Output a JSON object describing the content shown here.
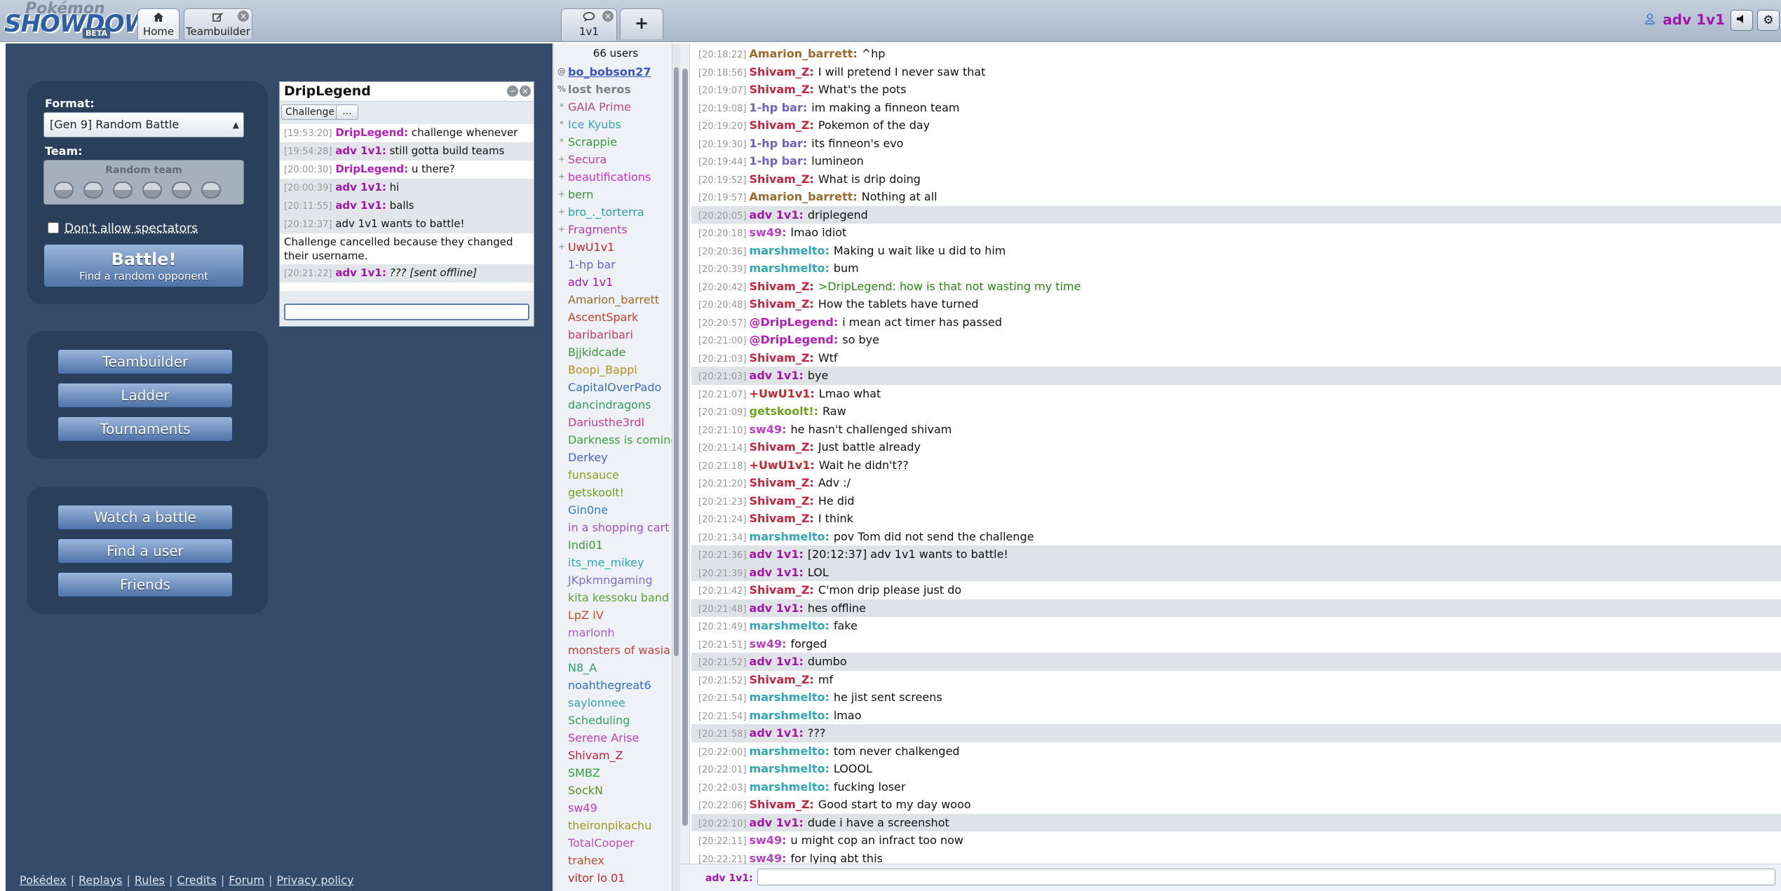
{
  "colors": {
    "accent": "#a316aa",
    "menu_bg": "#344c69",
    "button_blue": "#4e73a8"
  },
  "header": {
    "logo_top": "Pokémon",
    "logo_main": "SHOWDOWN",
    "logo_badge": "BETA",
    "tabs": {
      "home": {
        "icon": "home-icon",
        "label": "Home"
      },
      "teambuilder": {
        "icon": "edit-icon",
        "label": "Teambuilder"
      },
      "room": {
        "icon": "chat-bubble-icon",
        "label": "1v1"
      },
      "new_tab": "+"
    },
    "username": "adv 1v1"
  },
  "mainmenu": {
    "format_label": "Format:",
    "format_value": "[Gen 9] Random Battle",
    "team_label": "Team:",
    "team_value": "Random team",
    "spectators_label": "Don't allow spectators",
    "battle_button": {
      "title": "Battle!",
      "subtitle": "Find a random opponent"
    },
    "group2": [
      "Teambuilder",
      "Ladder",
      "Tournaments"
    ],
    "group3": [
      "Watch a battle",
      "Find a user",
      "Friends"
    ],
    "footer_links": [
      "Pokédex",
      "Replays",
      "Rules",
      "Credits",
      "Forum",
      "Privacy policy"
    ]
  },
  "pm": {
    "title": "DripLegend",
    "challenge_button": "Challenge",
    "more_button": "...",
    "messages": [
      {
        "time": "[19:53:20]",
        "user": "DripLegend:",
        "color": "#b91cb9",
        "text": "challenge whenever",
        "alt": false
      },
      {
        "time": "[19:54:28]",
        "user": "adv 1v1:",
        "color": "#a316aa",
        "text": "still gotta build teams",
        "alt": true
      },
      {
        "time": "[20:00:30]",
        "user": "DripLegend:",
        "color": "#b91cb9",
        "text": "u there?",
        "alt": false
      },
      {
        "time": "[20:00:39]",
        "user": "adv 1v1:",
        "color": "#a316aa",
        "text": "hi",
        "alt": true
      },
      {
        "time": "[20:11:55]",
        "user": "adv 1v1:",
        "color": "#a316aa",
        "text": "balls",
        "alt": true
      },
      {
        "time": "[20:12:37]",
        "user": "",
        "color": "#111111",
        "text": "adv 1v1 wants to battle!",
        "alt": true
      },
      {
        "time": "",
        "user": "",
        "color": "#111111",
        "text": "Challenge cancelled because they changed their username.",
        "alt": false
      },
      {
        "time": "[20:21:22]",
        "user": "adv 1v1:",
        "color": "#a316aa",
        "text": "??? [sent offline]",
        "alt": true,
        "italic": true
      }
    ]
  },
  "userlist": {
    "count": "66 users",
    "users": [
      {
        "rank": "@",
        "name": "bo_bobson27",
        "color": "#3a54c9",
        "bold": true,
        "underline": true
      },
      {
        "rank": "%",
        "name": "lost heros",
        "color": "#7b8089",
        "bold": true
      },
      {
        "rank": "*",
        "name": "GAIA Prime",
        "color": "#c1457f"
      },
      {
        "rank": "*",
        "name": "Ice Kyubs",
        "color": "#3aa4b9"
      },
      {
        "rank": "*",
        "name": "Scrappie",
        "color": "#3a9a3a"
      },
      {
        "rank": "+",
        "name": "Secura",
        "color": "#c13f8f"
      },
      {
        "rank": "+",
        "name": "beautifications",
        "color": "#c92fc9"
      },
      {
        "rank": "+",
        "name": "bern",
        "color": "#3a8f3a"
      },
      {
        "rank": "+",
        "name": "bro_._torterra",
        "color": "#2f9bb0"
      },
      {
        "rank": "+",
        "name": "Fragments",
        "color": "#b43fb4"
      },
      {
        "rank": "+",
        "name": "UwU1v1",
        "color": "#c8242c"
      },
      {
        "rank": "",
        "name": "1-hp bar",
        "color": "#6f5fc9"
      },
      {
        "rank": "",
        "name": "adv 1v1",
        "color": "#a316aa"
      },
      {
        "rank": "",
        "name": "Amarion_barrett",
        "color": "#9a6b2c"
      },
      {
        "rank": "",
        "name": "AscentSpark",
        "color": "#c8402c"
      },
      {
        "rank": "",
        "name": "baribaribari",
        "color": "#c83f5f"
      },
      {
        "rank": "",
        "name": "Bjjkidcade",
        "color": "#3a9a3a"
      },
      {
        "rank": "",
        "name": "Boopi_Bappi",
        "color": "#b38f1f"
      },
      {
        "rank": "",
        "name": "CapitalOverPado",
        "color": "#3a6fc9"
      },
      {
        "rank": "",
        "name": "dancindragons",
        "color": "#2f9f5f"
      },
      {
        "rank": "",
        "name": "Dariusthe3rdl",
        "color": "#c93f8f"
      },
      {
        "rank": "",
        "name": "Darkness is coming",
        "color": "#3aa43a"
      },
      {
        "rank": "",
        "name": "Derkey",
        "color": "#4a5fd9"
      },
      {
        "rank": "",
        "name": "funsauce",
        "color": "#8f9f1f"
      },
      {
        "rank": "",
        "name": "getskoolt!",
        "color": "#6fa21f"
      },
      {
        "rank": "",
        "name": "Gin0ne",
        "color": "#2f7fc9"
      },
      {
        "rank": "",
        "name": "in a shopping cart",
        "color": "#a34fc9"
      },
      {
        "rank": "",
        "name": "Indi01",
        "color": "#3a9a3a"
      },
      {
        "rank": "",
        "name": "its_me_mikey",
        "color": "#2fa7b4"
      },
      {
        "rank": "",
        "name": "JKpkmngaming",
        "color": "#7f6fc9"
      },
      {
        "rank": "",
        "name": "kita kessoku band",
        "color": "#5f9f3a"
      },
      {
        "rank": "",
        "name": "LpZ IV",
        "color": "#c9502c"
      },
      {
        "rank": "",
        "name": "marlonh",
        "color": "#a35fc9"
      },
      {
        "rank": "",
        "name": "monsters of wasia",
        "color": "#c83f3f"
      },
      {
        "rank": "",
        "name": "N8_A",
        "color": "#2f9f6f"
      },
      {
        "rank": "",
        "name": "noahthegreat6",
        "color": "#2f6fc9"
      },
      {
        "rank": "",
        "name": "saylonnee",
        "color": "#3aa4b4"
      },
      {
        "rank": "",
        "name": "Scheduling",
        "color": "#3a9f5f"
      },
      {
        "rank": "",
        "name": "Serene Arise",
        "color": "#b93fb9"
      },
      {
        "rank": "",
        "name": "Shivam_Z",
        "color": "#c8243c"
      },
      {
        "rank": "",
        "name": "SMBZ",
        "color": "#2f9f3a"
      },
      {
        "rank": "",
        "name": "SockN",
        "color": "#5f8f1f"
      },
      {
        "rank": "",
        "name": "sw49",
        "color": "#b93fc9"
      },
      {
        "rank": "",
        "name": "theironpikachu",
        "color": "#9a9a1f"
      },
      {
        "rank": "",
        "name": "TotalCooper",
        "color": "#b94fb9"
      },
      {
        "rank": "",
        "name": "trahex",
        "color": "#b9502c"
      },
      {
        "rank": "",
        "name": "vitor lo 01",
        "color": "#c8242c"
      }
    ]
  },
  "chat": {
    "prompt_user": "adv 1v1:",
    "lines": [
      {
        "time": "[20:18:22]",
        "user": "Amarion_barrett:",
        "color": "#9a6b2c",
        "text": "^hp",
        "alt": false
      },
      {
        "time": "[20:18:56]",
        "user": "Shivam_Z:",
        "color": "#c8243c",
        "text": "I will pretend I never saw that",
        "alt": false
      },
      {
        "time": "[20:19:07]",
        "user": "Shivam_Z:",
        "color": "#c8243c",
        "text": "What's the pots",
        "alt": false
      },
      {
        "time": "[20:19:08]",
        "user": "1-hp bar:",
        "color": "#6f5fc9",
        "text": "im making a finneon team",
        "alt": false
      },
      {
        "time": "[20:19:20]",
        "user": "Shivam_Z:",
        "color": "#c8243c",
        "text": "Pokemon of the day",
        "alt": false
      },
      {
        "time": "[20:19:30]",
        "user": "1-hp bar:",
        "color": "#6f5fc9",
        "text": "its finneon's evo",
        "alt": false
      },
      {
        "time": "[20:19:44]",
        "user": "1-hp bar:",
        "color": "#6f5fc9",
        "text": "lumineon",
        "alt": false
      },
      {
        "time": "[20:19:52]",
        "user": "Shivam_Z:",
        "color": "#c8243c",
        "text": "What is drip doing",
        "alt": false
      },
      {
        "time": "[20:19:57]",
        "user": "Amarion_barrett:",
        "color": "#9a6b2c",
        "text": "Nothing at all",
        "alt": false
      },
      {
        "time": "[20:20:05]",
        "user": "adv 1v1:",
        "color": "#a316aa",
        "text": "driplegend",
        "alt": true
      },
      {
        "time": "[20:20:18]",
        "user": "sw49:",
        "color": "#b93fc9",
        "text": "lmao idiot",
        "alt": false
      },
      {
        "time": "[20:20:36]",
        "user": "marshmelto:",
        "color": "#2fa7b4",
        "text": "Making u wait like u did to him",
        "alt": false
      },
      {
        "time": "[20:20:39]",
        "user": "marshmelto:",
        "color": "#2fa7b4",
        "text": "bum",
        "alt": false
      },
      {
        "time": "[20:20:42]",
        "user": "Shivam_Z:",
        "color": "#c8243c",
        "text": ">DripLegend: how is that not wasting my time",
        "alt": false,
        "greentext": true
      },
      {
        "time": "[20:20:48]",
        "user": "Shivam_Z:",
        "color": "#c8243c",
        "text": "How the tablets have turned",
        "alt": false
      },
      {
        "time": "[20:20:57]",
        "user": "@DripLegend:",
        "color": "#b91cb9",
        "text": "i mean act timer has passed",
        "alt": false
      },
      {
        "time": "[20:21:00]",
        "user": "@DripLegend:",
        "color": "#b91cb9",
        "text": "so bye",
        "alt": false
      },
      {
        "time": "[20:21:03]",
        "user": "Shivam_Z:",
        "color": "#c8243c",
        "text": "Wtf",
        "alt": false
      },
      {
        "time": "[20:21:03]",
        "user": "adv 1v1:",
        "color": "#a316aa",
        "text": "bye",
        "alt": true
      },
      {
        "time": "[20:21:07]",
        "user": "+UwU1v1:",
        "color": "#c8242c",
        "text": "Lmao what",
        "alt": false
      },
      {
        "time": "[20:21:09]",
        "user": "getskoolt!:",
        "color": "#6fa21f",
        "text": "Raw",
        "alt": false
      },
      {
        "time": "[20:21:10]",
        "user": "sw49:",
        "color": "#b93fc9",
        "text": "he hasn't challenged shivam",
        "alt": false
      },
      {
        "time": "[20:21:14]",
        "user": "Shivam_Z:",
        "color": "#c8243c",
        "text": "Just battle already",
        "alt": false
      },
      {
        "time": "[20:21:18]",
        "user": "+UwU1v1:",
        "color": "#c8242c",
        "text": "Wait he didn't??",
        "alt": false
      },
      {
        "time": "[20:21:20]",
        "user": "Shivam_Z:",
        "color": "#c8243c",
        "text": "Adv :/",
        "alt": false
      },
      {
        "time": "[20:21:23]",
        "user": "Shivam_Z:",
        "color": "#c8243c",
        "text": "He did",
        "alt": false
      },
      {
        "time": "[20:21:24]",
        "user": "Shivam_Z:",
        "color": "#c8243c",
        "text": "I think",
        "alt": false
      },
      {
        "time": "[20:21:34]",
        "user": "marshmelto:",
        "color": "#2fa7b4",
        "text": "pov Tom did not send the challenge",
        "alt": false
      },
      {
        "time": "[20:21:36]",
        "user": "adv 1v1:",
        "color": "#a316aa",
        "text": "[20:12:37] adv 1v1 wants to battle!",
        "alt": true
      },
      {
        "time": "[20:21:39]",
        "user": "adv 1v1:",
        "color": "#a316aa",
        "text": "LOL",
        "alt": true
      },
      {
        "time": "[20:21:42]",
        "user": "Shivam_Z:",
        "color": "#c8243c",
        "text": "C'mon drip please just do",
        "alt": false
      },
      {
        "time": "[20:21:48]",
        "user": "adv 1v1:",
        "color": "#a316aa",
        "text": "hes offline",
        "alt": true
      },
      {
        "time": "[20:21:49]",
        "user": "marshmelto:",
        "color": "#2fa7b4",
        "text": "fake",
        "alt": false
      },
      {
        "time": "[20:21:51]",
        "user": "sw49:",
        "color": "#b93fc9",
        "text": "forged",
        "alt": false
      },
      {
        "time": "[20:21:52]",
        "user": "adv 1v1:",
        "color": "#a316aa",
        "text": "dumbo",
        "alt": true
      },
      {
        "time": "[20:21:52]",
        "user": "Shivam_Z:",
        "color": "#c8243c",
        "text": "mf",
        "alt": false
      },
      {
        "time": "[20:21:54]",
        "user": "marshmelto:",
        "color": "#2fa7b4",
        "text": "he jist sent screens",
        "alt": false
      },
      {
        "time": "[20:21:54]",
        "user": "marshmelto:",
        "color": "#2fa7b4",
        "text": "lmao",
        "alt": false
      },
      {
        "time": "[20:21:58]",
        "user": "adv 1v1:",
        "color": "#a316aa",
        "text": "???",
        "alt": true
      },
      {
        "time": "[20:22:00]",
        "user": "marshmelto:",
        "color": "#2fa7b4",
        "text": "tom never chalkenged",
        "alt": false
      },
      {
        "time": "[20:22:01]",
        "user": "marshmelto:",
        "color": "#2fa7b4",
        "text": "LOOOL",
        "alt": false
      },
      {
        "time": "[20:22:03]",
        "user": "marshmelto:",
        "color": "#2fa7b4",
        "text": "fucking loser",
        "alt": false
      },
      {
        "time": "[20:22:06]",
        "user": "Shivam_Z:",
        "color": "#c8243c",
        "text": "Good start to my day wooo",
        "alt": false
      },
      {
        "time": "[20:22:10]",
        "user": "adv 1v1:",
        "color": "#a316aa",
        "text": "dude i have a screenshot",
        "alt": true
      },
      {
        "time": "[20:22:11]",
        "user": "sw49:",
        "color": "#b93fc9",
        "text": "u might cop an infract too now",
        "alt": false
      },
      {
        "time": "[20:22:21]",
        "user": "sw49:",
        "color": "#b93fc9",
        "text": "for lying abt this",
        "alt": false
      }
    ]
  }
}
